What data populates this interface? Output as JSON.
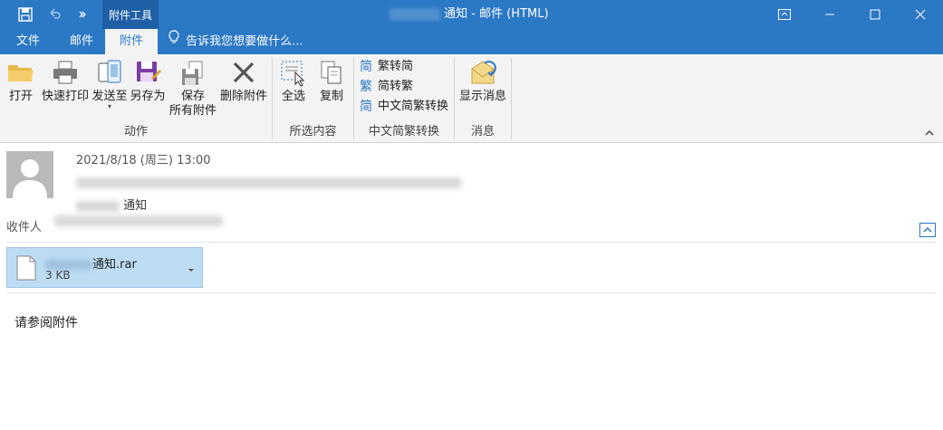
{
  "titlebar": {
    "context_tab": "附件工具",
    "title_suffix": "通知 - 邮件 (HTML)"
  },
  "tabs": [
    {
      "label": "文件"
    },
    {
      "label": "邮件"
    },
    {
      "label": "附件"
    }
  ],
  "tell_me": "告诉我您想要做什么...",
  "ribbon": {
    "groups": {
      "actions": "动作",
      "select": "所选内容",
      "convert": "中文简繁转换",
      "message": "消息"
    },
    "buttons": {
      "open": "打开",
      "quick_print": "快速打印",
      "send_to": "发送至",
      "save_as": "另存为",
      "save_all_1": "保存",
      "save_all_2": "所有附件",
      "delete_attachment": "删除附件",
      "select_all": "全选",
      "copy": "复制",
      "trad_to_simp": "繁转简",
      "simp_to_trad": "简转繁",
      "chinese_conversion": "中文简繁转换",
      "show_message": "显示消息"
    },
    "glyphs": {
      "trad_to_simp": "简",
      "simp_to_trad": "繁",
      "chinese_conversion": "简"
    }
  },
  "message": {
    "date": "2021/8/18 (周三) 13:00",
    "subject_suffix": "通知",
    "to_label": "收件人"
  },
  "attachment": {
    "name_suffix": "通知.rar",
    "size": "3 KB"
  },
  "body": "请参阅附件",
  "colors": {
    "accent": "#2b78c5",
    "attachment_bg": "#bcdcf4"
  }
}
